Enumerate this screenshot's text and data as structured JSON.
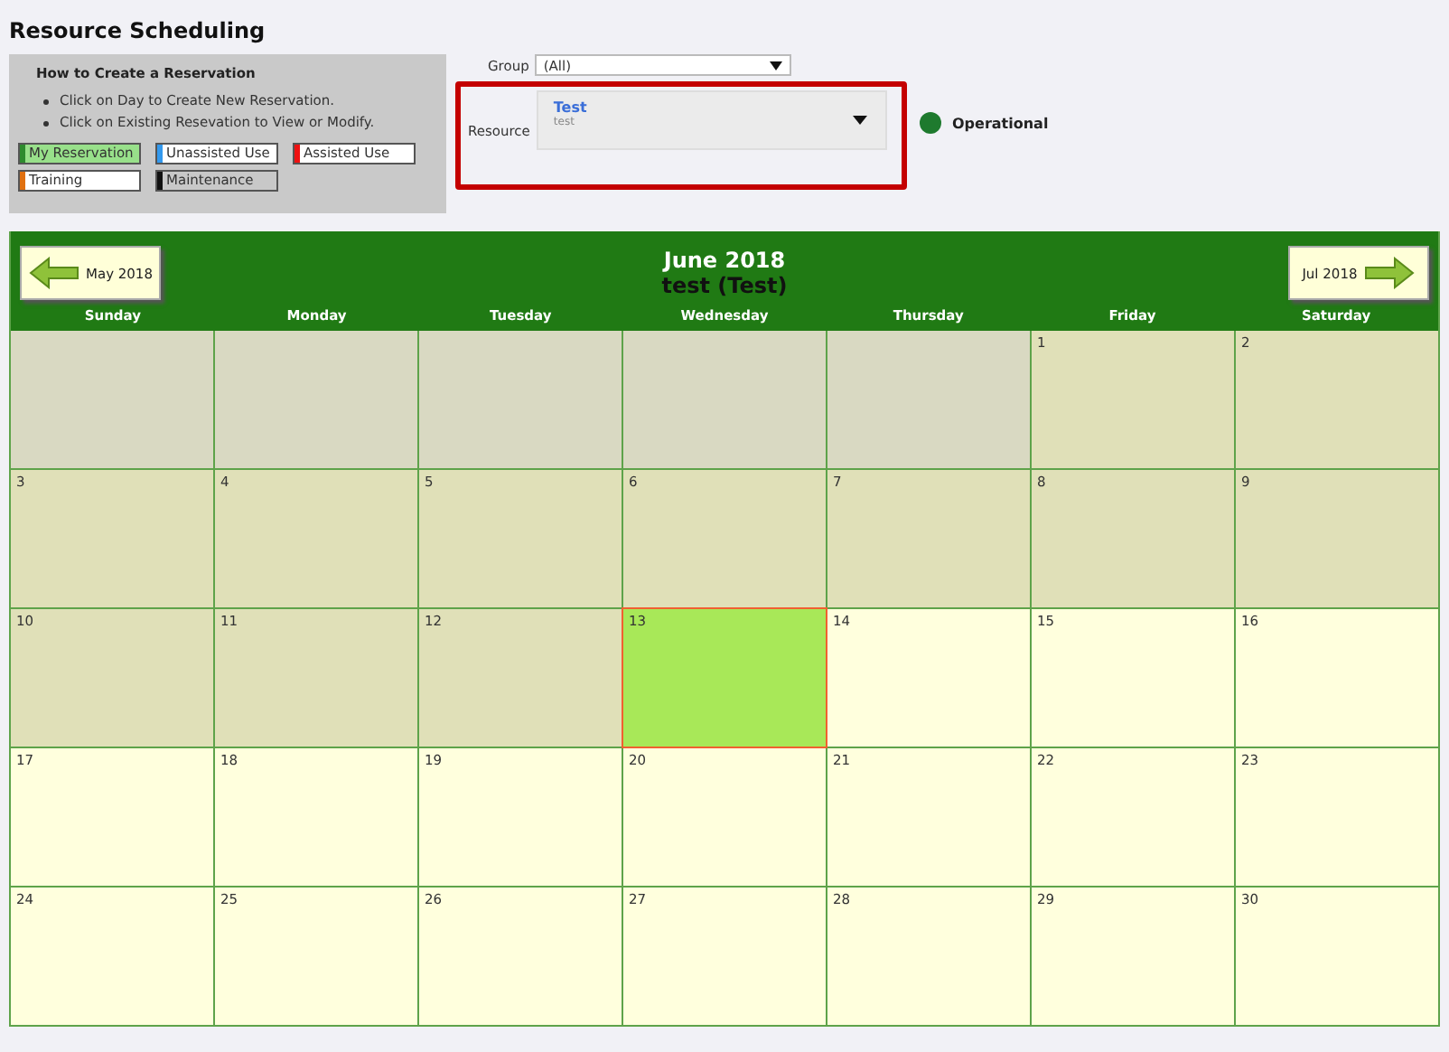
{
  "title": "Resource Scheduling",
  "help": {
    "heading": "How to Create a Reservation",
    "bullets": [
      "Click on Day to Create New Reservation.",
      "Click on Existing Resevation to View or Modify."
    ],
    "legend": [
      {
        "label": "My Reservation",
        "color": "#2e8b2e",
        "kind": "mine"
      },
      {
        "label": "Unassisted Use",
        "color": "#3399ee",
        "kind": "plain"
      },
      {
        "label": "Assisted Use",
        "color": "#ee1111",
        "kind": "plain"
      },
      {
        "label": "Training",
        "color": "#e07010",
        "kind": "plain"
      },
      {
        "label": "Maintenance",
        "color": "#111111",
        "kind": "blocked"
      }
    ]
  },
  "group": {
    "label": "Group",
    "value": "(All)"
  },
  "resource": {
    "label": "Resource",
    "name": "Test",
    "sub": "test",
    "highlighted": true
  },
  "status": {
    "label": "Operational",
    "color": "#1e7a2e"
  },
  "calendar": {
    "month": "June 2018",
    "subtitle": "test (Test)",
    "prev": "May 2018",
    "next": "Jul 2018",
    "weekdays": [
      "Sunday",
      "Monday",
      "Tuesday",
      "Wednesday",
      "Thursday",
      "Friday",
      "Saturday"
    ],
    "cells": [
      {
        "kind": "blank"
      },
      {
        "kind": "blank"
      },
      {
        "kind": "blank"
      },
      {
        "kind": "blank"
      },
      {
        "kind": "blank"
      },
      {
        "kind": "past",
        "day": "1"
      },
      {
        "kind": "past",
        "day": "2"
      },
      {
        "kind": "past",
        "day": "3"
      },
      {
        "kind": "past",
        "day": "4"
      },
      {
        "kind": "past",
        "day": "5"
      },
      {
        "kind": "past",
        "day": "6"
      },
      {
        "kind": "past",
        "day": "7"
      },
      {
        "kind": "past",
        "day": "8"
      },
      {
        "kind": "past",
        "day": "9"
      },
      {
        "kind": "past",
        "day": "10"
      },
      {
        "kind": "past",
        "day": "11"
      },
      {
        "kind": "past",
        "day": "12"
      },
      {
        "kind": "today",
        "day": "13"
      },
      {
        "kind": "future",
        "day": "14"
      },
      {
        "kind": "future",
        "day": "15"
      },
      {
        "kind": "future",
        "day": "16"
      },
      {
        "kind": "future",
        "day": "17"
      },
      {
        "kind": "future",
        "day": "18"
      },
      {
        "kind": "future",
        "day": "19"
      },
      {
        "kind": "future",
        "day": "20"
      },
      {
        "kind": "future",
        "day": "21"
      },
      {
        "kind": "future",
        "day": "22"
      },
      {
        "kind": "future",
        "day": "23"
      },
      {
        "kind": "future",
        "day": "24"
      },
      {
        "kind": "future",
        "day": "25"
      },
      {
        "kind": "future",
        "day": "26"
      },
      {
        "kind": "future",
        "day": "27"
      },
      {
        "kind": "future",
        "day": "28"
      },
      {
        "kind": "future",
        "day": "29"
      },
      {
        "kind": "future",
        "day": "30"
      }
    ]
  }
}
